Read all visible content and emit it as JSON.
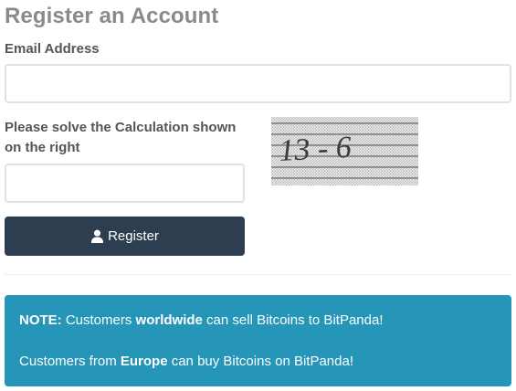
{
  "form": {
    "title": "Register an Account",
    "email_label": "Email Address",
    "email_value": "",
    "calc_label": "Please solve the Calculation shown on the right",
    "calc_value": "",
    "captcha_text": "13 - 6",
    "register_label": "Register",
    "register_icon": "user-icon",
    "button_color": "#2c3e50"
  },
  "note": {
    "line1": {
      "prefix": "NOTE:",
      "text_a": " Customers ",
      "emphasis": "worldwide",
      "text_b": " can sell Bitcoins to BitPanda!"
    },
    "line2": {
      "text_a": "Customers from ",
      "emphasis": "Europe",
      "text_b": " can buy Bitcoins on BitPanda!"
    },
    "background_color": "#2595b8"
  }
}
